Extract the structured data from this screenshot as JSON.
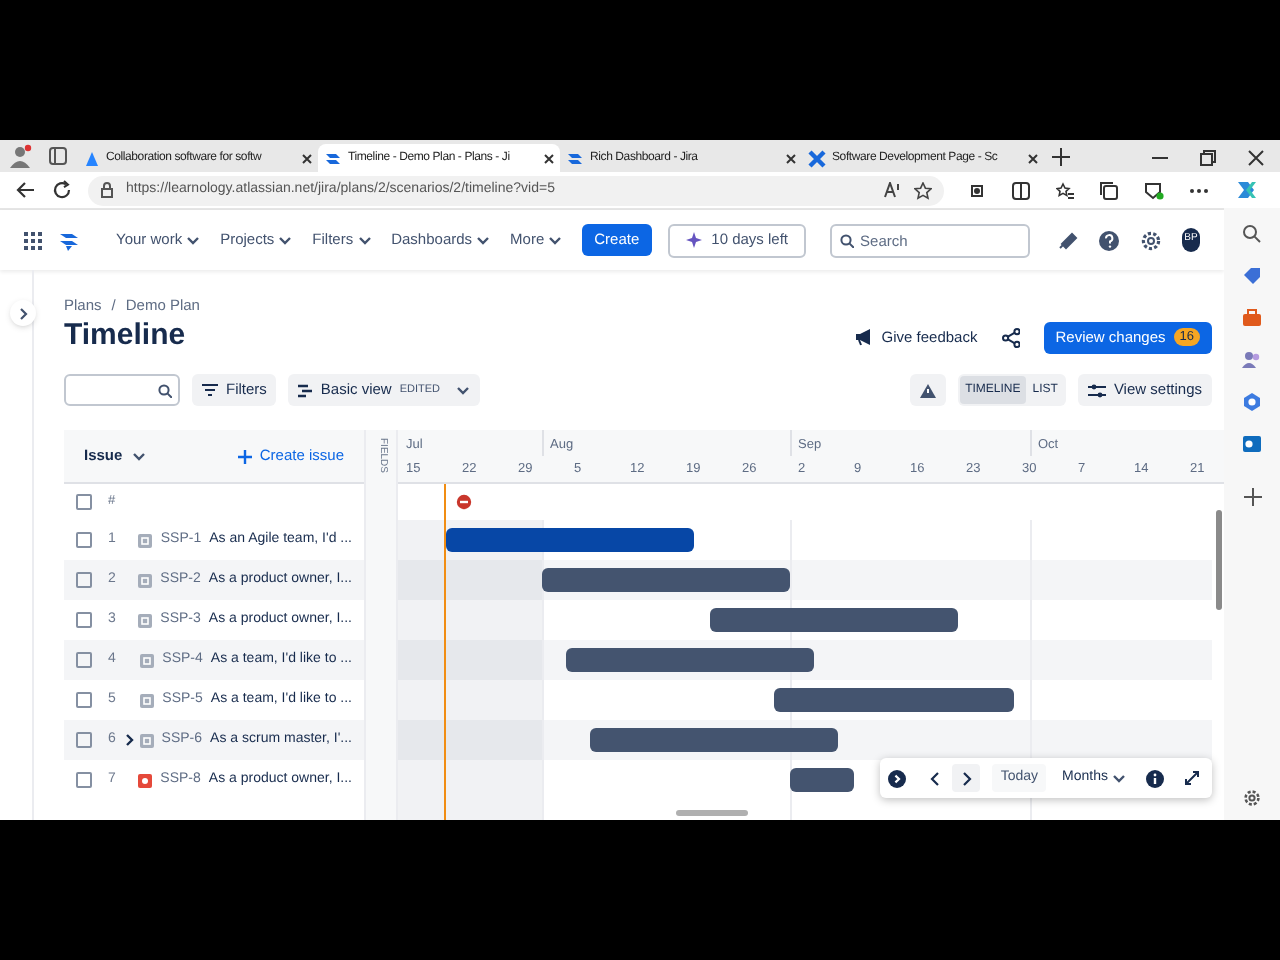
{
  "browser": {
    "tabs": [
      {
        "title": "Collaboration software for softw",
        "kind": "atlassian",
        "selected": false
      },
      {
        "title": "Timeline - Demo Plan - Plans - Ji",
        "kind": "jira",
        "selected": true
      },
      {
        "title": "Rich Dashboard - Jira",
        "kind": "jira",
        "selected": false
      },
      {
        "title": "Software Development Page - Sc",
        "kind": "confluence",
        "selected": false
      }
    ],
    "url": "https://learnology.atlassian.net/jira/plans/2/scenarios/2/timeline?vid=5"
  },
  "nav": {
    "items": [
      "Your work",
      "Projects",
      "Filters",
      "Dashboards",
      "More"
    ],
    "create": "Create",
    "trial": "10 days left",
    "search_placeholder": "Search",
    "avatar": "BP"
  },
  "breadcrumbs": {
    "items": [
      "Plans",
      "Demo Plan"
    ],
    "separator": "/"
  },
  "title": "Timeline",
  "feedback": "Give feedback",
  "review": {
    "label": "Review changes",
    "count": "16"
  },
  "toolbar": {
    "filters": "Filters",
    "view": "Basic view",
    "view_badge": "EDITED",
    "view_modes": [
      {
        "label": "TIMELINE",
        "selected": true
      },
      {
        "label": "LIST",
        "selected": false
      }
    ],
    "view_settings": "View settings"
  },
  "table": {
    "issue_header": "Issue",
    "create_issue": "Create issue",
    "fields_label": "FIELDS",
    "number_header": "#",
    "all_checked": false,
    "rows": [
      {
        "num": "1",
        "key": "SSP-1",
        "summary": "As an Agile team, I'd ...",
        "kind": "story",
        "has_children": false,
        "checked": false,
        "highlighted": true
      },
      {
        "num": "2",
        "key": "SSP-2",
        "summary": "As a product owner, I...",
        "kind": "story",
        "has_children": false,
        "checked": false,
        "highlighted": false
      },
      {
        "num": "3",
        "key": "SSP-3",
        "summary": "As a product owner, I...",
        "kind": "story",
        "has_children": false,
        "checked": false,
        "highlighted": false
      },
      {
        "num": "4",
        "key": "SSP-4",
        "summary": "As a team, I'd like to ...",
        "kind": "story",
        "has_children": false,
        "checked": false,
        "highlighted": false
      },
      {
        "num": "5",
        "key": "SSP-5",
        "summary": "As a team, I'd like to ...",
        "kind": "story",
        "has_children": false,
        "checked": false,
        "highlighted": false
      },
      {
        "num": "6",
        "key": "SSP-6",
        "summary": "As a scrum master, I'...",
        "kind": "story",
        "has_children": true,
        "checked": false,
        "highlighted": false
      },
      {
        "num": "7",
        "key": "SSP-8",
        "summary": "As a product owner, I...",
        "kind": "bug",
        "has_children": false,
        "checked": false,
        "highlighted": false
      }
    ]
  },
  "timeline": {
    "months": [
      "Jul",
      "Aug",
      "Sep",
      "Oct"
    ],
    "weeks": [
      "15",
      "22",
      "29",
      "5",
      "12",
      "19",
      "26",
      "2",
      "9",
      "16",
      "23",
      "30",
      "7",
      "14",
      "21"
    ]
  },
  "controls": {
    "today": "Today",
    "scale": "Months"
  }
}
